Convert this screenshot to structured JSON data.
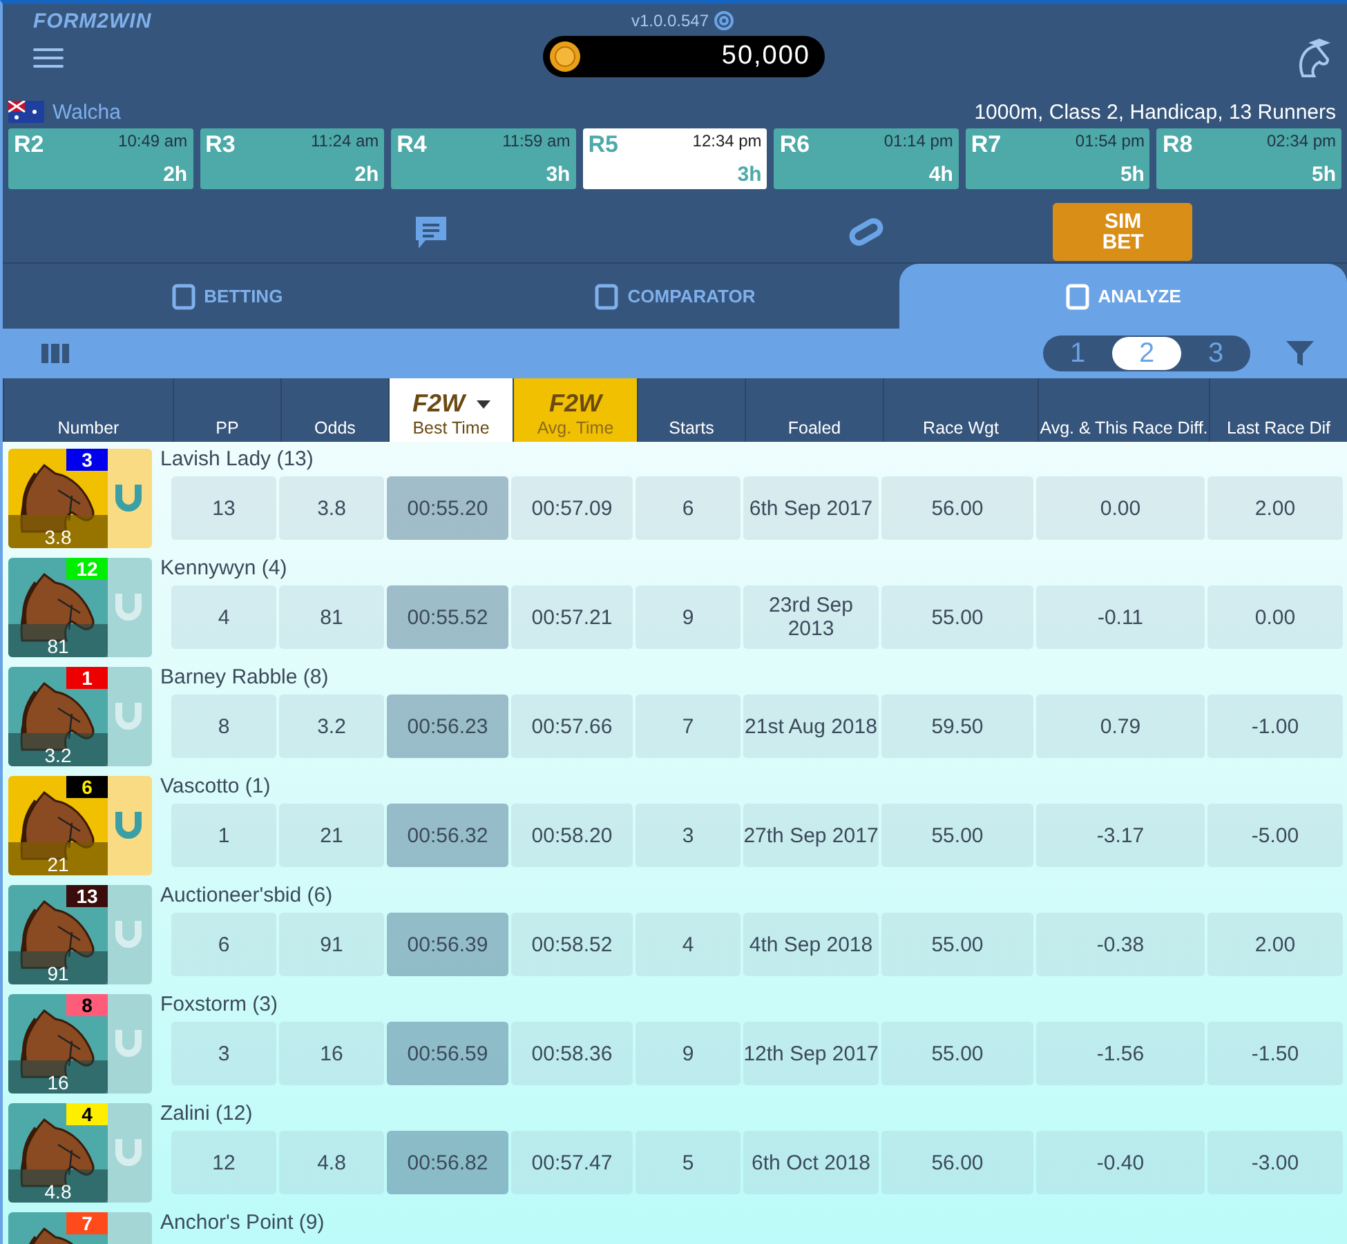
{
  "header": {
    "logo": "FORM2WIN",
    "version": "v1.0.0.547",
    "balance": "50,000"
  },
  "meeting": {
    "venue": "Walcha",
    "race_info": "1000m, Class 2, Handicap, 13 Runners"
  },
  "races": [
    {
      "label": "R2",
      "time": "10:49 am",
      "eta": "2h",
      "selected": false
    },
    {
      "label": "R3",
      "time": "11:24 am",
      "eta": "2h",
      "selected": false
    },
    {
      "label": "R4",
      "time": "11:59 am",
      "eta": "3h",
      "selected": false
    },
    {
      "label": "R5",
      "time": "12:34 pm",
      "eta": "3h",
      "selected": true
    },
    {
      "label": "R6",
      "time": "01:14 pm",
      "eta": "4h",
      "selected": false
    },
    {
      "label": "R7",
      "time": "01:54 pm",
      "eta": "5h",
      "selected": false
    },
    {
      "label": "R8",
      "time": "02:34 pm",
      "eta": "5h",
      "selected": false
    }
  ],
  "sim_bet": "SIM BET",
  "tabs": [
    {
      "label": "BETTING",
      "selected": false
    },
    {
      "label": "COMPARATOR",
      "selected": false
    },
    {
      "label": "ANALYZE",
      "selected": true
    }
  ],
  "pages": [
    {
      "label": "1",
      "selected": false
    },
    {
      "label": "2",
      "selected": true
    },
    {
      "label": "3",
      "selected": false
    }
  ],
  "columns": [
    {
      "label": "Number",
      "kind": "plain",
      "selected": false
    },
    {
      "label": "PP",
      "kind": "plain",
      "selected": false
    },
    {
      "label": "Odds",
      "kind": "plain",
      "selected": false
    },
    {
      "label": "Best Time",
      "kind": "f2w",
      "badge": "F2W",
      "selected": true
    },
    {
      "label": "Avg. Time",
      "kind": "f2w",
      "badge": "F2W",
      "selected": false
    },
    {
      "label": "Starts",
      "kind": "plain",
      "selected": false
    },
    {
      "label": "Foaled",
      "kind": "plain",
      "selected": false
    },
    {
      "label": "Race Wgt",
      "kind": "plain",
      "selected": false
    },
    {
      "label": "Avg. & This Race Diff.",
      "kind": "plain",
      "selected": false
    },
    {
      "label": "Last Race Dif",
      "kind": "plain",
      "selected": false
    }
  ],
  "runners": [
    {
      "name": "Lavish Lady (13)",
      "number": "3",
      "color": "#0000ee",
      "odds": "3.8",
      "favourite": true,
      "cells": [
        "13",
        "3.8",
        "00:55.20",
        "00:57.09",
        "6",
        "6th Sep 2017",
        "56.00",
        "0.00",
        "2.00"
      ]
    },
    {
      "name": "Kennywyn (4)",
      "number": "12",
      "color": "#00ee00",
      "odds": "81",
      "favourite": false,
      "cells": [
        "4",
        "81",
        "00:55.52",
        "00:57.21",
        "9",
        "23rd Sep 2013",
        "55.00",
        "-0.11",
        "0.00"
      ]
    },
    {
      "name": "Barney Rabble (8)",
      "number": "1",
      "color": "#ee0000",
      "odds": "3.2",
      "favourite": false,
      "cells": [
        "8",
        "3.2",
        "00:56.23",
        "00:57.66",
        "7",
        "21st Aug 2018",
        "59.50",
        "0.79",
        "-1.00"
      ]
    },
    {
      "name": "Vascotto (1)",
      "number": "6",
      "color": "#000000",
      "odds": "21",
      "favourite": true,
      "cells": [
        "1",
        "21",
        "00:56.32",
        "00:58.20",
        "3",
        "27th Sep 2017",
        "55.00",
        "-3.17",
        "-5.00"
      ]
    },
    {
      "name": "Auctioneer'sbid (6)",
      "number": "13",
      "color": "#3a0c0c",
      "odds": "91",
      "favourite": false,
      "cells": [
        "6",
        "91",
        "00:56.39",
        "00:58.52",
        "4",
        "4th Sep 2018",
        "55.00",
        "-0.38",
        "2.00"
      ]
    },
    {
      "name": "Foxstorm (3)",
      "number": "8",
      "color": "#ff5c7a",
      "odds": "16",
      "favourite": false,
      "cells": [
        "3",
        "16",
        "00:56.59",
        "00:58.36",
        "9",
        "12th Sep 2017",
        "55.00",
        "-1.56",
        "-1.50"
      ]
    },
    {
      "name": "Zalini (12)",
      "number": "4",
      "color": "#ffee00",
      "odds": "4.8",
      "favourite": false,
      "cells": [
        "12",
        "4.8",
        "00:56.82",
        "00:57.47",
        "5",
        "6th Oct 2018",
        "56.00",
        "-0.40",
        "-3.00"
      ]
    },
    {
      "name": "Anchor's Point (9)",
      "number": "7",
      "color": "#ff4a1c",
      "favourite": false
    }
  ]
}
